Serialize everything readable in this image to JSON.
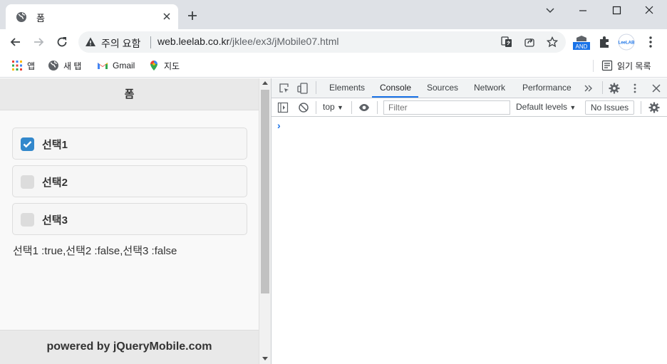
{
  "browser": {
    "tab_title": "폼",
    "omnibox": {
      "security_label": "주의 요함",
      "url_host": "web.leelab.co.kr",
      "url_path": "/jklee/ex3/jMobile07.html"
    },
    "extension_label": "AND",
    "profile_label": "LeeLAB",
    "bookmarks": [
      {
        "label": "앱",
        "icon": "apps-grid-icon"
      },
      {
        "label": "새 탭",
        "icon": "globe-icon"
      },
      {
        "label": "Gmail",
        "icon": "gmail-icon"
      },
      {
        "label": "지도",
        "icon": "maps-pin-icon"
      }
    ],
    "reading_list": "읽기 목록"
  },
  "page": {
    "header_title": "폼",
    "checkboxes": [
      {
        "label": "선택1",
        "checked": true
      },
      {
        "label": "선택2",
        "checked": false
      },
      {
        "label": "선택3",
        "checked": false
      }
    ],
    "result_text": "선택1 :true,선택2 :false,선택3 :false",
    "footer": "powered by jQueryMobile.com"
  },
  "devtools": {
    "tabs": [
      "Elements",
      "Console",
      "Sources",
      "Network",
      "Performance"
    ],
    "active_tab": "Console",
    "context": "top",
    "filter_placeholder": "Filter",
    "levels": "Default levels",
    "issues": "No Issues",
    "prompt": "›"
  },
  "colors": {
    "accent": "#1a73e8",
    "checkbox_on": "#3388cc"
  }
}
